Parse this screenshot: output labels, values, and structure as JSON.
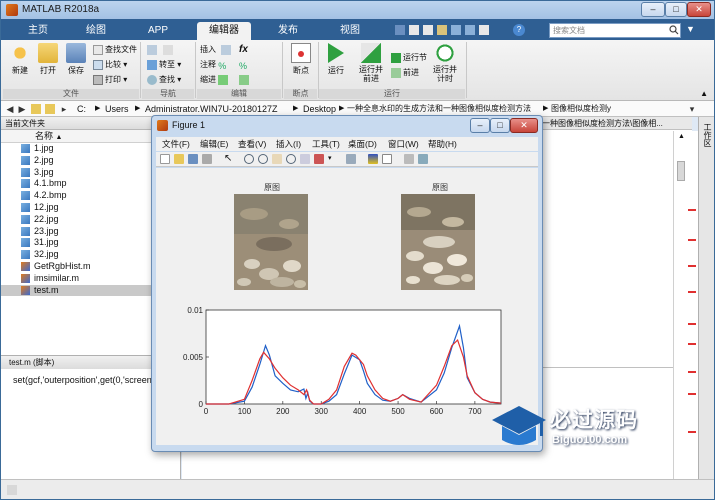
{
  "window": {
    "title": "MATLAB R2018a"
  },
  "tabs": [
    "主页",
    "绘图",
    "APP",
    "编辑器",
    "发布",
    "视图"
  ],
  "active_tab": "编辑器",
  "search": {
    "placeholder": "搜索文档"
  },
  "ribbon": {
    "file_group": {
      "new": "新建",
      "open": "打开",
      "save": "保存",
      "find_files": "查找文件",
      "compare": "比较",
      "print": "打印",
      "label": "文件"
    },
    "nav_group": {
      "goto": "转至",
      "find": "查找",
      "label": "导航"
    },
    "edit_group": {
      "insert": "插入",
      "comment": "注释",
      "indent": "缩进",
      "fx": "fx",
      "label": "编辑"
    },
    "breakpoint_group": {
      "breakpoints": "断点",
      "label": "断点"
    },
    "run_group": {
      "run": "运行",
      "run_advance": "运行并\n前进",
      "run_section": "运行节",
      "advance": "前进",
      "run_time": "运行并\n计时",
      "label": "运行"
    }
  },
  "address": [
    "C:",
    "Users",
    "Administrator.WIN7U-20180127Z",
    "Desktop",
    "一种全息水印的生成方法和一种图像相似度检测方法",
    "图像相似度检测y"
  ],
  "current_folder": {
    "header": "当前文件夹",
    "column": "名称",
    "files": [
      {
        "name": "1.jpg",
        "type": "img"
      },
      {
        "name": "2.jpg",
        "type": "img"
      },
      {
        "name": "3.jpg",
        "type": "img"
      },
      {
        "name": "4.1.bmp",
        "type": "img"
      },
      {
        "name": "4.2.bmp",
        "type": "img"
      },
      {
        "name": "12.jpg",
        "type": "img"
      },
      {
        "name": "22.jpg",
        "type": "img"
      },
      {
        "name": "23.jpg",
        "type": "img"
      },
      {
        "name": "31.jpg",
        "type": "img"
      },
      {
        "name": "32.jpg",
        "type": "img"
      },
      {
        "name": "GetRgbHist.m",
        "type": "m"
      },
      {
        "name": "imsimilar.m",
        "type": "m"
      },
      {
        "name": "test.m",
        "type": "m",
        "selected": true
      }
    ]
  },
  "details": {
    "header": "test.m  (脚本)",
    "code": "set(gcf,'outerposition',get(0,'screen"
  },
  "editor": {
    "tab_path": "一种图像相似度检测方法\\图像相..."
  },
  "right_panel": {
    "label": "工作区"
  },
  "figure": {
    "title": "Figure 1",
    "menu": [
      "文件(F)",
      "编辑(E)",
      "查看(V)",
      "插入(I)",
      "工具(T)",
      "桌面(D)",
      "窗口(W)",
      "帮助(H)"
    ],
    "image_titles": [
      "原图",
      "原图"
    ]
  },
  "chart_data": {
    "type": "line",
    "xlim": [
      0,
      768
    ],
    "ylim": [
      0,
      0.01
    ],
    "xticks": [
      "0",
      "100",
      "200",
      "300",
      "400",
      "500",
      "600",
      "700"
    ],
    "yticks": [
      "0",
      "0.005",
      "0.01"
    ],
    "grid": false,
    "series": [
      {
        "color": "#2060c8",
        "x": [
          0,
          60,
          100,
          120,
          140,
          155,
          165,
          180,
          200,
          220,
          240,
          255,
          260,
          265,
          270,
          280,
          300,
          320,
          340,
          360,
          380,
          400,
          410,
          420,
          440,
          460,
          480,
          500,
          512,
          530,
          560,
          600,
          620,
          640,
          660,
          670,
          680,
          700,
          720,
          740,
          768
        ],
        "y": [
          0,
          0,
          0.0003,
          0.0018,
          0.0042,
          0.0062,
          0.0052,
          0.003,
          0.0022,
          0.0015,
          0.0013,
          0.0016,
          0.0006,
          0.0012,
          0.0003,
          0,
          0,
          0.0003,
          0.001,
          0.0032,
          0.0052,
          0.0047,
          0.0035,
          0.0022,
          0.001,
          0.0004,
          0.0003,
          0.0006,
          0.001,
          0.0006,
          0.0002,
          0.0015,
          0.0033,
          0.006,
          0.0083,
          0.006,
          0.0028,
          0.0012,
          0.0005,
          0.0002,
          0.0001
        ]
      },
      {
        "color": "#e03030",
        "x": [
          0,
          60,
          100,
          120,
          140,
          150,
          165,
          180,
          200,
          220,
          240,
          255,
          262,
          270,
          280,
          300,
          320,
          340,
          360,
          380,
          390,
          410,
          420,
          440,
          460,
          480,
          500,
          512,
          530,
          560,
          600,
          620,
          640,
          655,
          670,
          680,
          700,
          720,
          740,
          768
        ],
        "y": [
          0,
          0,
          0.0005,
          0.0025,
          0.0048,
          0.0055,
          0.0048,
          0.0038,
          0.0028,
          0.002,
          0.0015,
          0.001,
          0.0015,
          0.0004,
          0,
          0,
          0.0005,
          0.0015,
          0.004,
          0.0054,
          0.0052,
          0.0042,
          0.003,
          0.0015,
          0.0006,
          0.0003,
          0.0006,
          0.001,
          0.0005,
          0.0002,
          0.002,
          0.004,
          0.0062,
          0.0068,
          0.005,
          0.003,
          0.0012,
          0.0005,
          0.0002,
          0.0001
        ]
      }
    ]
  },
  "watermark": {
    "title": "必过源码",
    "url": "Biguo100.com"
  }
}
